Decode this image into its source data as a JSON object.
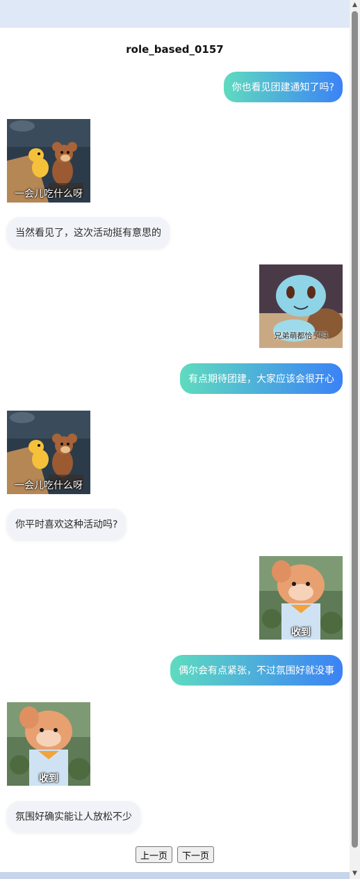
{
  "page_title": "role_based_0157",
  "messages": [
    {
      "side": "right",
      "text": "你也看见团建通知了吗?"
    },
    {
      "side": "left",
      "sticker_caption": "一会儿吃什么呀"
    },
    {
      "side": "left",
      "text": "当然看见了，这次活动挺有意思的"
    },
    {
      "side": "right",
      "sticker_caption": "兄弟萌都恰了吗"
    },
    {
      "side": "right",
      "text": "有点期待团建，大家应该会很开心"
    },
    {
      "side": "left",
      "sticker_caption": "一会儿吃什么呀"
    },
    {
      "side": "left",
      "text": "你平时喜欢这种活动吗?"
    },
    {
      "side": "right",
      "sticker_caption": "收到"
    },
    {
      "side": "right",
      "text": "偶尔会有点紧张，不过氛围好就没事"
    },
    {
      "side": "left",
      "sticker_caption": "收到"
    },
    {
      "side": "left",
      "text": "氛围好确实能让人放松不少"
    }
  ],
  "pagination": {
    "prev_label": "上一页",
    "next_label": "下一页"
  },
  "scrollbar": {
    "up_icon": "▲",
    "down_icon": "▼"
  },
  "colors": {
    "right_bubble_start": "#5fdbbf",
    "right_bubble_end": "#3b82f6",
    "left_bubble": "#f1f3f8"
  }
}
